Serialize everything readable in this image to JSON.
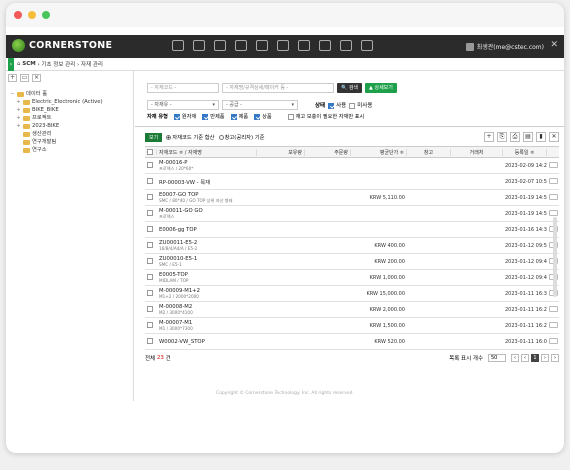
{
  "header": {
    "brand": "CORNERSTONE",
    "user": "최생관(me@cstec.com)"
  },
  "breadcrumb": {
    "home": "SCM",
    "path": "› 기초 정보 관리 › 자재 관리"
  },
  "sidebar": {
    "items": [
      {
        "label": "데이터 홀",
        "level": 0
      },
      {
        "label": "Electric_Electronic (Active)",
        "level": 1
      },
      {
        "label": "BIKE_BIKE",
        "level": 1
      },
      {
        "label": "프로젝트",
        "level": 1
      },
      {
        "label": "2023-BIKE",
        "level": 1
      },
      {
        "label": "생산관리",
        "level": 1
      },
      {
        "label": "연구개발팀",
        "level": 1
      },
      {
        "label": "연구소",
        "level": 1
      }
    ]
  },
  "search": {
    "code_placeholder": "- 자재코드 -",
    "name_placeholder": "- 자재명/규격상세/메이커 등 -",
    "search_btn": "검색",
    "detail_btn": "상세보기",
    "select1": "- 자재유 -",
    "select2": "- 공급 -",
    "status_label": "상태",
    "status_use": "사용",
    "status_unused": "미사용",
    "type_label": "자재 유형",
    "types": [
      "원자재",
      "반제품",
      "제품",
      "상품"
    ],
    "stock_note": "재고 보충이 필요한 자재만 표시"
  },
  "table": {
    "tag": "보기",
    "radio1": "자재코드 기준 합산",
    "radio2": "창고(공리자) 기준",
    "headers": [
      "자재코드 ≑ / 자재명",
      "보유량",
      "주문량",
      "평균단가 ≑",
      "창고",
      "거래처",
      "등록일 ≑"
    ],
    "rows": [
      {
        "code": "M-00016-P",
        "sub": "프로젝스 / 20*60*",
        "price": "",
        "date": "2023-02-09 14:29"
      },
      {
        "code": "RP-00003-VW - 목재",
        "sub": "",
        "price": "",
        "date": "2023-02-07 10:53"
      },
      {
        "code": "E0007-GO TOP",
        "sub": "SMC / 80*40 / GO TOP 상위 자산 형태",
        "price": "KRW 5,110.00",
        "date": "2023-01-19 14:54"
      },
      {
        "code": "M-00011-GO GO",
        "sub": "프로젝스",
        "price": "",
        "date": "2023-01-19 14:51"
      },
      {
        "code": "E0006-gg TOP",
        "sub": "",
        "price": "",
        "date": "2023-01-16 14:33"
      },
      {
        "code": "ZU00011-E5-2",
        "sub": "16/8/4/A4/A / E5-2",
        "price": "KRW 400.00",
        "date": "2023-01-12 09:51"
      },
      {
        "code": "ZU00010-E5-1",
        "sub": "SMC / E5-1",
        "price": "KRW 200.00",
        "date": "2023-01-12 09:49"
      },
      {
        "code": "E0005-TOP",
        "sub": "MIDLAM / TOP",
        "price": "KRW 1,000.00",
        "date": "2023-01-12 09:47"
      },
      {
        "code": "M-00009-M1+2",
        "sub": "M1+2 / 2000*2000",
        "price": "KRW 15,000.00",
        "date": "2023-01-11 16:31"
      },
      {
        "code": "M-00008-M2",
        "sub": "M2 / 3000*4100",
        "price": "KRW 2,000.00",
        "date": "2023-01-11 16:29"
      },
      {
        "code": "M-00007-M1",
        "sub": "M1 / 3000*7300",
        "price": "KRW 1,500.00",
        "date": "2023-01-11 16:26"
      },
      {
        "code": "W0002-VW_STOP",
        "sub": "",
        "price": "KRW 520.00",
        "date": "2023-01-11 16:05"
      }
    ]
  },
  "footer": {
    "total_prefix": "전체",
    "total_count": "23",
    "total_suffix": "건",
    "page_size_label": "목록 표시 개수",
    "page_size": "50",
    "current_page": "1"
  },
  "copyright": "Copyright © Cornerstone Technology. Inc. All rights reserved."
}
